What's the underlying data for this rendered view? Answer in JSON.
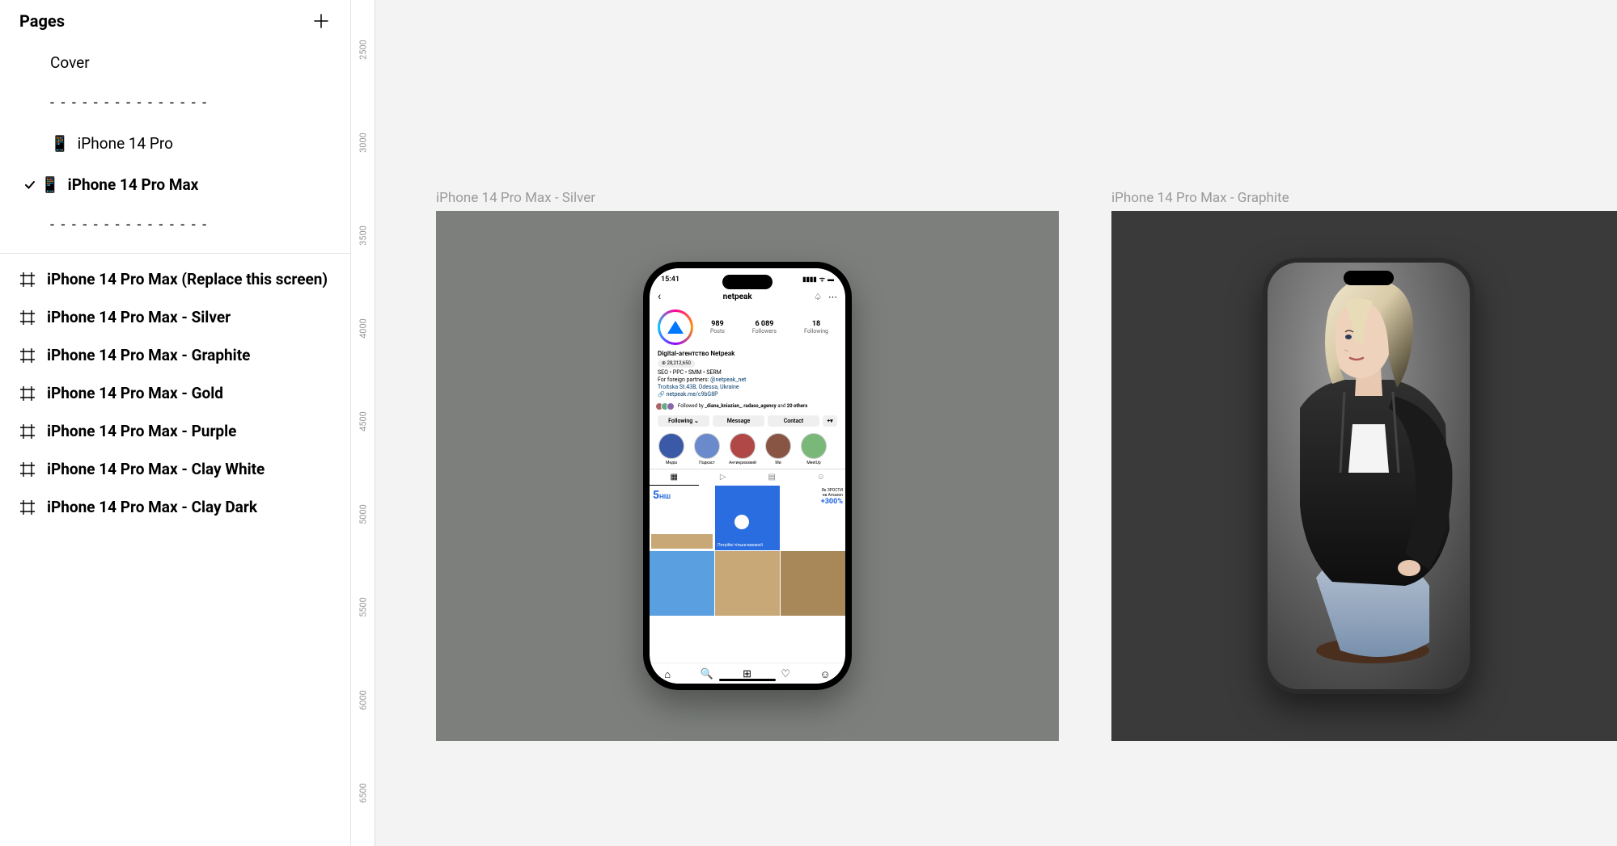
{
  "sidebar": {
    "title": "Pages",
    "pages": [
      {
        "label": "Cover",
        "selected": false,
        "hasPhoneIcon": false
      },
      {
        "label": "- - - - - - - - - - - - - - -",
        "separator": true
      },
      {
        "label": "iPhone 14 Pro",
        "selected": false,
        "hasPhoneIcon": true
      },
      {
        "label": "iPhone 14 Pro Max",
        "selected": true,
        "hasPhoneIcon": true
      },
      {
        "label": "- - - - - - - - - - - - - - -",
        "separator": true
      }
    ],
    "layers": [
      {
        "label": "iPhone 14 Pro Max (Replace this screen)"
      },
      {
        "label": "iPhone 14 Pro Max - Silver"
      },
      {
        "label": "iPhone 14 Pro Max - Graphite"
      },
      {
        "label": "iPhone 14 Pro Max - Gold"
      },
      {
        "label": "iPhone 14 Pro Max - Purple"
      },
      {
        "label": "iPhone 14 Pro Max - Clay White"
      },
      {
        "label": "iPhone 14 Pro Max - Clay Dark"
      }
    ]
  },
  "ruler": [
    "2500",
    "3000",
    "3500",
    "4000",
    "4500",
    "5000",
    "5500",
    "6000",
    "6500"
  ],
  "canvas": {
    "frames": {
      "silver": {
        "label": "iPhone 14 Pro Max - Silver"
      },
      "graphite": {
        "label": "iPhone 14 Pro Max - Graphite"
      }
    }
  },
  "ig": {
    "time": "15:41",
    "username": "netpeak",
    "stats": {
      "posts_n": "989",
      "posts_l": "Posts",
      "followers_n": "6 089",
      "followers_l": "Followers",
      "following_n": "18",
      "following_l": "Following"
    },
    "bio": {
      "name": "Digital-агентство Netpeak",
      "chip": "⊕ 28,212,650",
      "line1": "SEO • PPC • SMM • SERM",
      "line2a": "For foreign partners: ",
      "line2b": "@netpeak_net",
      "line3": "Troitska St.43B, Odessa, Ukraine",
      "link": "netpeak.me/c9bG8P"
    },
    "followed": {
      "a": "Followed by ",
      "b": "_diana_kniazian_",
      "c": ", ",
      "d": "radaso_agency",
      "e": " and ",
      "f": "20 others"
    },
    "buttons": {
      "following": "Following ⌄",
      "message": "Message",
      "contact": "Contact",
      "add": "+▾"
    },
    "highlights": [
      {
        "label": "Медіа",
        "color": "#3a5aa8"
      },
      {
        "label": "Подкаст",
        "color": "#6a8acc"
      },
      {
        "label": "Антикризовий",
        "color": "#b04848"
      },
      {
        "label": "Ми",
        "color": "#885544"
      },
      {
        "label": "MeetUp",
        "color": "#7ab87a"
      }
    ],
    "grid": {
      "c1": {
        "big": "5",
        "suffix": "НІШ"
      },
      "c2": {
        "txt": "Потрібні тільки вакансії"
      },
      "c3": {
        "a": "Як ЗРОСТИ",
        "b": "на Amazon",
        "c": "+300%"
      }
    },
    "nav": [
      "⌂",
      "🔍",
      "⊞",
      "♡",
      "☺"
    ]
  }
}
